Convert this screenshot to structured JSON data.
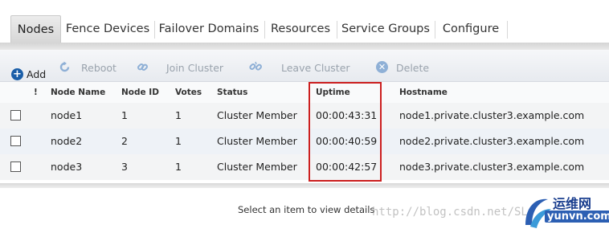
{
  "tabs": [
    {
      "label": "Nodes",
      "active": true
    },
    {
      "label": "Fence Devices",
      "active": false
    },
    {
      "label": "Failover Domains",
      "active": false
    },
    {
      "label": "Resources",
      "active": false
    },
    {
      "label": "Service Groups",
      "active": false
    },
    {
      "label": "Configure",
      "active": false
    }
  ],
  "toolbar": {
    "add": "Add",
    "reboot": "Reboot",
    "join": "Join Cluster",
    "leave": "Leave Cluster",
    "delete": "Delete"
  },
  "table": {
    "headers": {
      "alert": "!",
      "name": "Node Name",
      "id": "Node ID",
      "votes": "Votes",
      "status": "Status",
      "uptime": "Uptime",
      "hostname": "Hostname"
    },
    "rows": [
      {
        "name": "node1",
        "id": "1",
        "votes": "1",
        "status": "Cluster Member",
        "uptime": "00:00:43:31",
        "hostname": "node1.private.cluster3.example.com"
      },
      {
        "name": "node2",
        "id": "2",
        "votes": "1",
        "status": "Cluster Member",
        "uptime": "00:00:40:59",
        "hostname": "node2.private.cluster3.example.com"
      },
      {
        "name": "node3",
        "id": "3",
        "votes": "1",
        "status": "Cluster Member",
        "uptime": "00:00:42:57",
        "hostname": "node3.private.cluster3.example.com"
      }
    ]
  },
  "details": {
    "empty_text": "Select an item to view details"
  },
  "watermark": "http://blog.csdn.net/SL",
  "logo": {
    "cn": "运维网",
    "en": "yunvn.com"
  },
  "colors": {
    "highlight_border": "#cc1f1f",
    "add_icon": "#1a5ea8",
    "disabled_icon": "#8fb0d6"
  }
}
